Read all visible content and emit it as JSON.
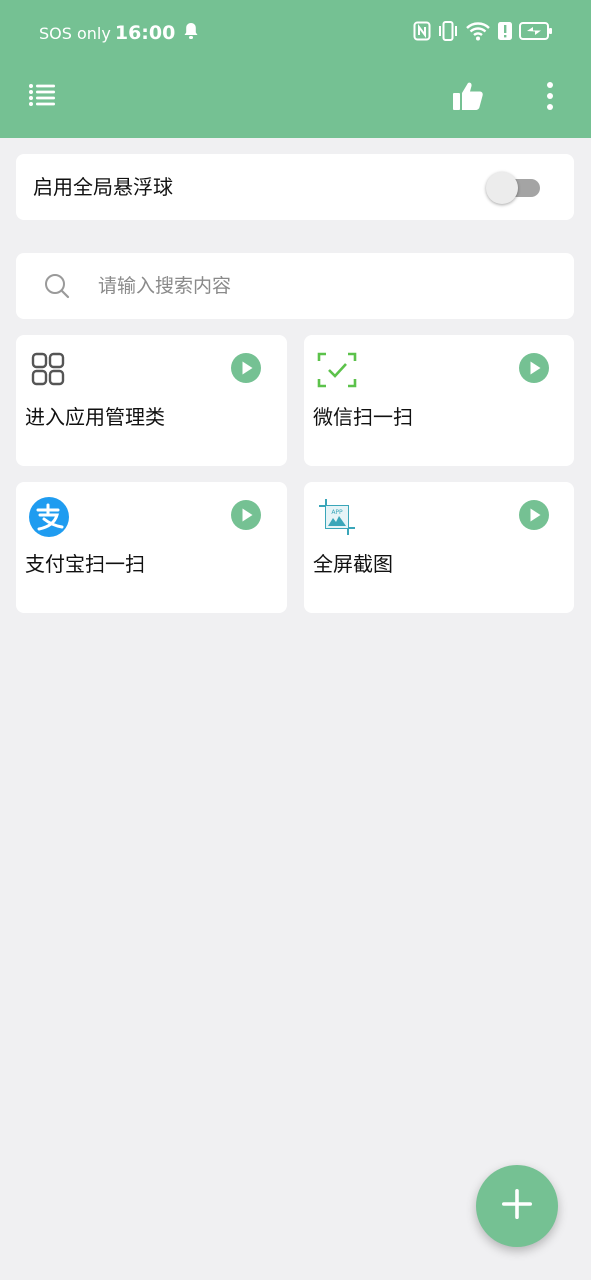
{
  "status_bar": {
    "carrier": "SOS only",
    "time": "16:00",
    "icons": [
      "bell-icon",
      "nfc-icon",
      "vibrate-icon",
      "wifi-icon",
      "alert-icon",
      "battery-charging-icon"
    ]
  },
  "toolbar": {
    "menu_icon": "list-menu-icon",
    "like_icon": "thumbs-up-icon",
    "more_icon": "more-vertical-icon"
  },
  "floating_ball": {
    "label": "启用全局悬浮球",
    "enabled": false
  },
  "search": {
    "placeholder": "请输入搜索内容",
    "value": ""
  },
  "tiles": [
    {
      "label": "进入应用管理类",
      "icon": "app-grid-icon"
    },
    {
      "label": "微信扫一扫",
      "icon": "wechat-scan-icon"
    },
    {
      "label": "支付宝扫一扫",
      "icon": "alipay-icon"
    },
    {
      "label": "全屏截图",
      "icon": "screenshot-icon"
    }
  ],
  "colors": {
    "accent": "#75c193",
    "background": "#f0f0f2",
    "card": "#ffffff",
    "alipay_blue": "#1f9cf0",
    "wechat_green": "#5cc24b",
    "screenshot_teal": "#3aa6b9"
  },
  "fab": {
    "icon": "plus-icon"
  }
}
